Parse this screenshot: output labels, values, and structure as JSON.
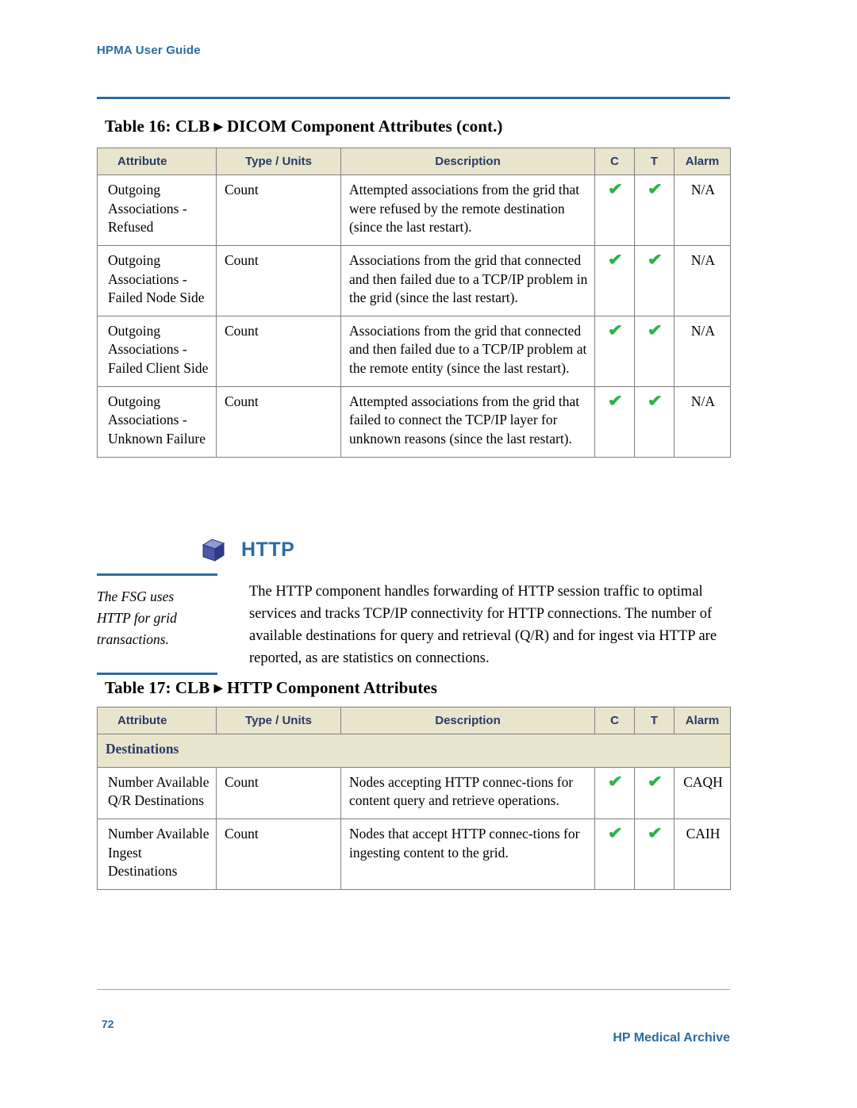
{
  "header": {
    "title": "HPMA User Guide"
  },
  "footer": {
    "page_number": "72",
    "right_text": "HP Medical Archive"
  },
  "table16": {
    "caption_prefix": "Table 16: CLB",
    "caption_arrow": "▶",
    "caption_suffix": "DICOM Component Attributes (cont.)",
    "columns": [
      "Attribute",
      "Type / Units",
      "Description",
      "C",
      "T",
      "Alarm"
    ],
    "rows": [
      {
        "attribute": "Outgoing Associations - Refused",
        "type": "Count",
        "description": "Attempted associations from the grid that were refused by the remote destination (since the last restart).",
        "c": "✔",
        "t": "✔",
        "alarm": "N/A"
      },
      {
        "attribute": "Outgoing Associations - Failed Node Side",
        "type": "Count",
        "description": "Associations from the grid that connected and then failed due to a TCP/IP problem in the grid (since the last restart).",
        "c": "✔",
        "t": "✔",
        "alarm": "N/A"
      },
      {
        "attribute": "Outgoing Associations - Failed Client Side",
        "type": "Count",
        "description": "Associations from the grid that connected and then failed due to a TCP/IP problem at the remote entity (since the last restart).",
        "c": "✔",
        "t": "✔",
        "alarm": "N/A"
      },
      {
        "attribute": "Outgoing Associations - Unknown Failure",
        "type": "Count",
        "description": "Attempted associations from the grid that failed to connect the TCP/IP layer for unknown reasons (since the last restart).",
        "c": "✔",
        "t": "✔",
        "alarm": "N/A"
      }
    ]
  },
  "http_section": {
    "icon": "cube-icon",
    "title": "HTTP",
    "note": "The FSG uses HTTP for grid transactions.",
    "body": "The HTTP component handles forwarding of HTTP session traffic to optimal services and tracks TCP/IP connectivity for HTTP connections. The number of available destinations for query and retrieval (Q/R) and for ingest via HTTP are reported, as are statistics on connections."
  },
  "table17": {
    "caption_prefix": "Table 17: CLB",
    "caption_arrow": "▶",
    "caption_suffix": "HTTP Component Attributes",
    "columns": [
      "Attribute",
      "Type / Units",
      "Description",
      "C",
      "T",
      "Alarm"
    ],
    "section_label": "Destinations",
    "rows": [
      {
        "attribute": "Number Available Q/R Destinations",
        "type": "Count",
        "description": "Nodes accepting HTTP connec-tions for content query and retrieve operations.",
        "c": "✔",
        "t": "✔",
        "alarm": "CAQH"
      },
      {
        "attribute": "Number Available Ingest Destinations",
        "type": "Count",
        "description": "Nodes that accept HTTP connec-tions for ingesting content to the grid.",
        "c": "✔",
        "t": "✔",
        "alarm": "CAIH"
      }
    ]
  },
  "colors": {
    "accent_blue": "#2b6ca3",
    "header_fill": "#e9e5cd",
    "header_text": "#2b3a66",
    "check_green": "#2cb34a",
    "footer_rule": "#c9a227"
  }
}
